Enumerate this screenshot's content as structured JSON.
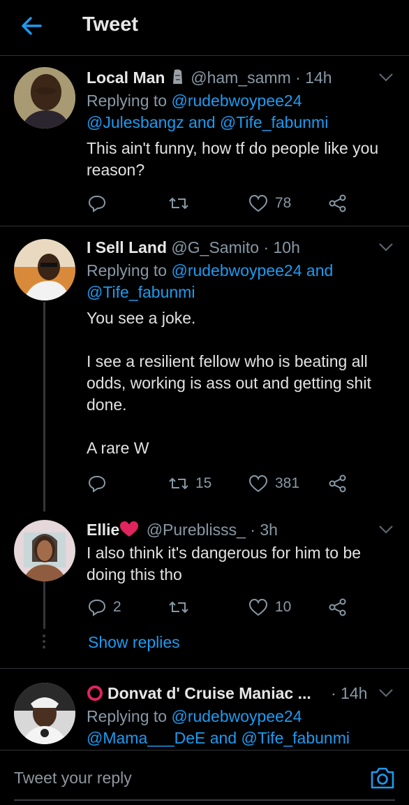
{
  "header": {
    "title": "Tweet"
  },
  "tweets": [
    {
      "name": "Local Man",
      "handle": "@ham_samm",
      "time": "· 14h",
      "replying_prefix": "Replying to ",
      "replying_line1_mention": "@rudebwoypee24",
      "replying_line2_mention1": "@Julesbangz",
      "replying_and": " and ",
      "replying_line2_mention2": "@Tife_fabunmi",
      "text": "This ain't funny, how tf do people like you reason?",
      "reply_count": "",
      "retweet_count": "",
      "like_count": "78"
    },
    {
      "name": "I Sell Land",
      "handle": "@G_Samito",
      "time": "· 10h",
      "replying_prefix": "Replying to ",
      "replying_line1_mention": "@rudebwoypee24",
      "replying_and": " and",
      "replying_line2_mention1": "@Tife_fabunmi",
      "text": "You see a joke.\n\nI see a resilient fellow who is beating all odds, working is ass out and getting shit done.\n\nA rare W",
      "reply_count": "",
      "retweet_count": "15",
      "like_count": "381"
    },
    {
      "name": "Ellie",
      "handle": "@Pureblisss_",
      "time": "· 3h",
      "text": "I also think it's dangerous for him to be doing this tho",
      "reply_count": "2",
      "retweet_count": "",
      "like_count": "10",
      "show_replies": "Show replies"
    },
    {
      "name": "Donvat d' Cruise Maniac ...",
      "time": "· 14h",
      "replying_prefix": "Replying to ",
      "replying_line1_mention": "@rudebwoypee24",
      "replying_line2_mention1": "@Mama___DeE",
      "replying_and": " and ",
      "replying_line2_mention2": "@Tife_fabunmi"
    }
  ],
  "compose": {
    "placeholder": "Tweet your reply"
  },
  "colors": {
    "accent": "#1d9bf0",
    "background": "#000000",
    "muted": "#8899a6",
    "heart": "#e0245e",
    "stop": "#e0245e"
  },
  "icons": [
    "back-arrow-icon",
    "chevron-down-icon",
    "reply-icon",
    "retweet-icon",
    "like-icon",
    "share-icon",
    "camera-icon",
    "moai-emoji-icon",
    "red-heart-emoji-icon",
    "red-circle-emoji-icon"
  ]
}
